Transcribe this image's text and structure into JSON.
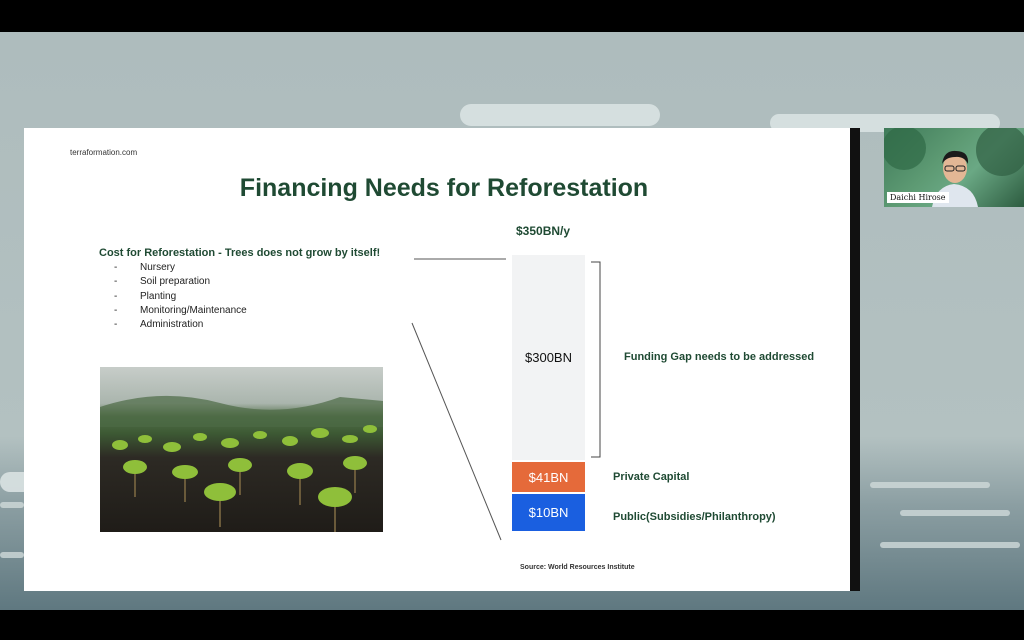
{
  "slide": {
    "site": "terraformation.com",
    "title": "Financing Needs for Reforestation",
    "total_label": "$350BN/y",
    "cost_heading": "Cost for Reforestation  - Trees does not grow by itself!",
    "cost_items": [
      "Nursery",
      "Soil preparation",
      "Planting",
      "Monitoring/Maintenance",
      "Administration"
    ],
    "bar": {
      "gap_value": "$300BN",
      "private_value": "$41BN",
      "public_value": "$10BN"
    },
    "labels": {
      "gap": "Funding Gap needs to be addressed",
      "private": "Private Capital",
      "public": "Public(Subsidies/Philanthropy)"
    },
    "source": "Source: World Resources Institute"
  },
  "video": {
    "participant_name": "Daichi Hirose"
  },
  "colors": {
    "title_green": "#1f4a33",
    "private_orange": "#e56a3a",
    "public_blue": "#1a5fe0",
    "gap_grey": "#f2f3f4"
  }
}
